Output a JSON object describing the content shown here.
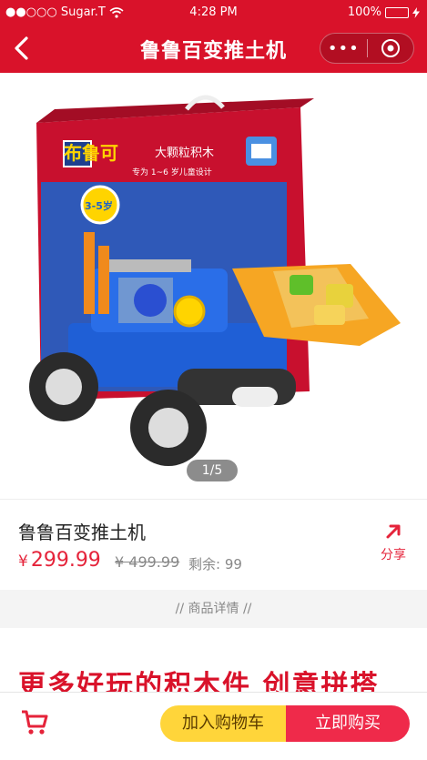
{
  "status_bar": {
    "carrier": "●●○○○ Sugar.T",
    "time": "4:28 PM",
    "battery": "100%",
    "battery_level": 1.0
  },
  "nav": {
    "title": "鲁鲁百变推土机",
    "more_label": "•••"
  },
  "gallery": {
    "pager": "1/5",
    "box_brand": "布鲁可",
    "box_tagline": "大颗粒积木",
    "box_subline": "专为 1~6 岁儿童设计",
    "age_badge": "3-5岁"
  },
  "product": {
    "name": "鲁鲁百变推土机",
    "currency": "¥",
    "price": "299.99",
    "original_price": "¥ 499.99",
    "stock": "剩余: 99",
    "share_label": "分享"
  },
  "detail": {
    "divider": "// 商品详情 //",
    "promo_text": "更多好玩的积木件 创意拼搭"
  },
  "actions": {
    "add_to_cart": "加入购物车",
    "buy_now": "立即购买"
  },
  "colors": {
    "brand_red": "#d9122a",
    "price_red": "#e5233a",
    "cart_yellow": "#ffd53a",
    "buy_red": "#ef2a4a"
  }
}
